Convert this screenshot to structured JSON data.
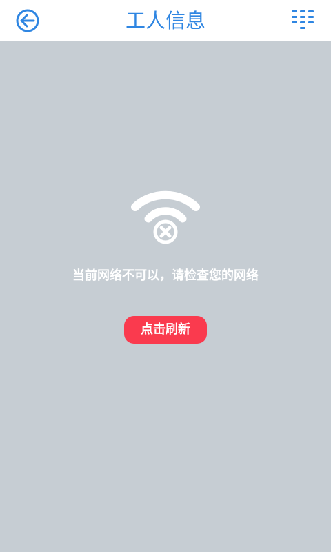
{
  "header": {
    "title": "工人信息",
    "back_icon": "back-arrow-circle-icon",
    "menu_icon": "list-menu-icon"
  },
  "status": {
    "icon": "wifi-error-icon",
    "message": "当前网络不可以，请检查您的网络"
  },
  "actions": {
    "refresh_label": "点击刷新"
  },
  "colors": {
    "accent": "#2f86e2",
    "background": "#c6cdd3",
    "button": "#fa3a4e"
  }
}
